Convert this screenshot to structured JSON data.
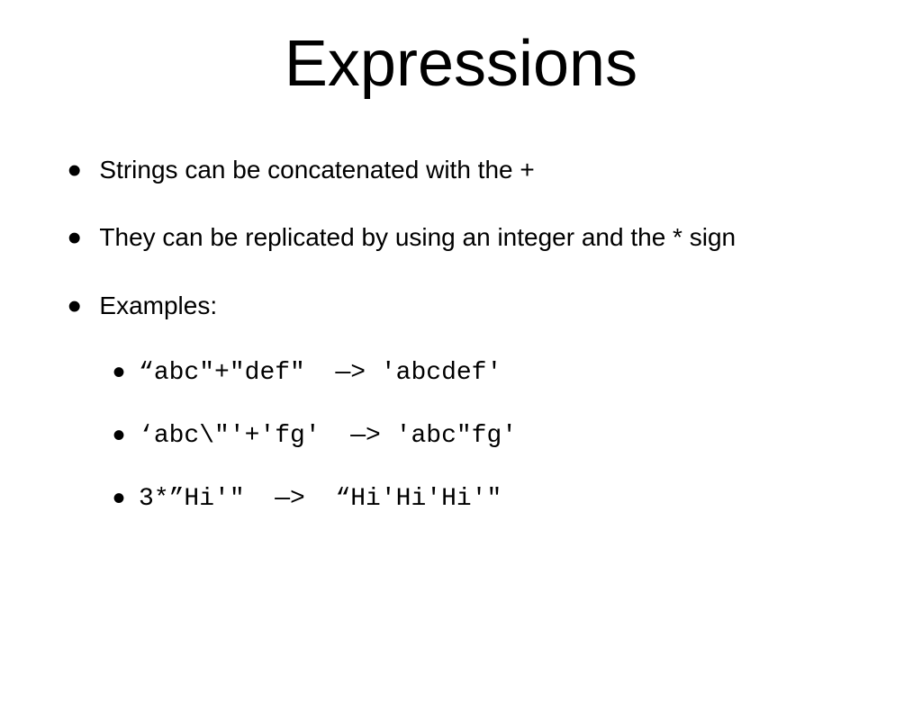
{
  "title": "Expressions",
  "bullets": [
    {
      "text": "Strings can be concatenated with the +"
    },
    {
      "text": "They can be replicated by using an integer and the * sign"
    },
    {
      "text": "Examples:"
    }
  ],
  "examples": [
    {
      "code": "“abc\"+\"def\"  —> 'abcdef'"
    },
    {
      "code": "‘abc\\\"'+'fg'  —> 'abc\"fg'"
    },
    {
      "code": "3*”Hi'\"  —>  “Hi'Hi'Hi'\""
    }
  ]
}
